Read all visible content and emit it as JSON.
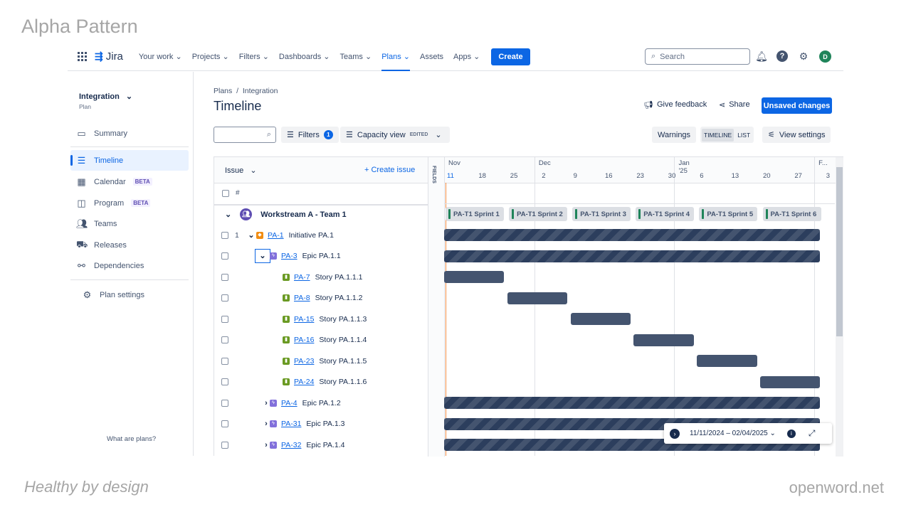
{
  "slide": {
    "title": "Alpha Pattern",
    "footer_left": "Healthy by design",
    "footer_right": "openword.net"
  },
  "nav": {
    "logo": "Jira",
    "items": [
      {
        "label": "Your work ⌄"
      },
      {
        "label": "Projects ⌄"
      },
      {
        "label": "Filters ⌄"
      },
      {
        "label": "Dashboards ⌄"
      },
      {
        "label": "Teams ⌄"
      },
      {
        "label": "Plans ⌄",
        "active": true
      },
      {
        "label": "Assets"
      },
      {
        "label": "Apps ⌄"
      }
    ],
    "create": "Create",
    "search_placeholder": "Search",
    "avatar": "D"
  },
  "sidebar": {
    "plan_name": "Integration",
    "plan_type": "Plan",
    "items": [
      {
        "label": "Summary",
        "icon": "summary-icon"
      },
      {
        "label": "Timeline",
        "icon": "timeline-icon",
        "active": true
      },
      {
        "label": "Calendar",
        "badge": "BETA",
        "icon": "calendar-icon"
      },
      {
        "label": "Program",
        "badge": "BETA",
        "icon": "program-icon"
      },
      {
        "label": "Teams",
        "icon": "teams-icon"
      },
      {
        "label": "Releases",
        "icon": "releases-icon"
      },
      {
        "label": "Dependencies",
        "icon": "dependencies-icon"
      }
    ],
    "settings": "Plan settings",
    "help": "What are plans?"
  },
  "header": {
    "breadcrumb": [
      "Plans",
      "/",
      "Integration"
    ],
    "title": "Timeline",
    "feedback": "Give feedback",
    "share": "Share",
    "unsaved": "Unsaved changes"
  },
  "toolbar": {
    "filters": "Filters",
    "filter_count": "1",
    "view": "Capacity view",
    "view_badge": "EDITED",
    "warnings": "Warnings",
    "timeline": "TIMELINE",
    "list": "LIST",
    "view_settings": "View settings"
  },
  "table": {
    "issue_header": "Issue",
    "create_issue": "+ Create issue",
    "hash": "#",
    "fields": "FIELDS",
    "group": "Workstream A - Team 1",
    "rows": [
      {
        "num": "1",
        "key": "PA-1",
        "title": "Initiative PA.1",
        "type": "initiative",
        "start": "2024-11-11",
        "end": "2025-02-02",
        "striped": true,
        "chev": "⌄"
      },
      {
        "key": "PA-3",
        "title": "Epic PA.1.1",
        "type": "epic",
        "start": "2024-11-11",
        "end": "2025-02-02",
        "striped": true,
        "chev": "⌄"
      },
      {
        "key": "PA-7",
        "title": "Story PA.1.1.1",
        "type": "story",
        "start": "2024-11-11",
        "end": "2024-11-24"
      },
      {
        "key": "PA-8",
        "title": "Story PA.1.1.2",
        "type": "story",
        "start": "2024-11-25",
        "end": "2024-12-08"
      },
      {
        "key": "PA-15",
        "title": "Story PA.1.1.3",
        "type": "story",
        "start": "2024-12-09",
        "end": "2024-12-22"
      },
      {
        "key": "PA-16",
        "title": "Story PA.1.1.4",
        "type": "story",
        "start": "2024-12-23",
        "end": "2025-01-05"
      },
      {
        "key": "PA-23",
        "title": "Story PA.1.1.5",
        "type": "story",
        "start": "2025-01-06",
        "end": "2025-01-19"
      },
      {
        "key": "PA-24",
        "title": "Story PA.1.1.6",
        "type": "story",
        "start": "2025-01-20",
        "end": "2025-02-02"
      },
      {
        "key": "PA-4",
        "title": "Epic PA.1.2",
        "type": "epic",
        "start": "2024-11-11",
        "end": "2025-02-02",
        "striped": true,
        "chev": "›"
      },
      {
        "key": "PA-31",
        "title": "Epic PA.1.3",
        "type": "epic",
        "start": "2024-11-11",
        "end": "2025-02-02",
        "striped": true,
        "chev": "›"
      },
      {
        "key": "PA-32",
        "title": "Epic PA.1.4",
        "type": "epic",
        "start": "2024-11-11",
        "end": "2025-02-02",
        "striped": true,
        "chev": "›"
      }
    ]
  },
  "timeline": {
    "months": [
      {
        "label": "Nov",
        "date": "2024-11-01"
      },
      {
        "label": "Dec",
        "date": "2024-12-01"
      },
      {
        "label": "Jan '25",
        "date": "2025-01-01"
      },
      {
        "label": "F...",
        "date": "2025-02-01"
      }
    ],
    "days": [
      "11",
      "18",
      "25",
      "2",
      "9",
      "16",
      "23",
      "30",
      "6",
      "13",
      "20",
      "27",
      "3"
    ],
    "sprints": [
      "PA-T1 Sprint 1",
      "PA-T1 Sprint 2",
      "PA-T1 Sprint 3",
      "PA-T1 Sprint 4",
      "PA-T1 Sprint 5",
      "PA-T1 Sprint 6"
    ],
    "range": "11/11/2024 – 02/04/2025 ⌄",
    "today": "2024-11-11"
  },
  "colors": {
    "accent": "#0c66e4",
    "bar": "#44546f",
    "sprint": "#1f845a",
    "today": "#f38a3f"
  }
}
